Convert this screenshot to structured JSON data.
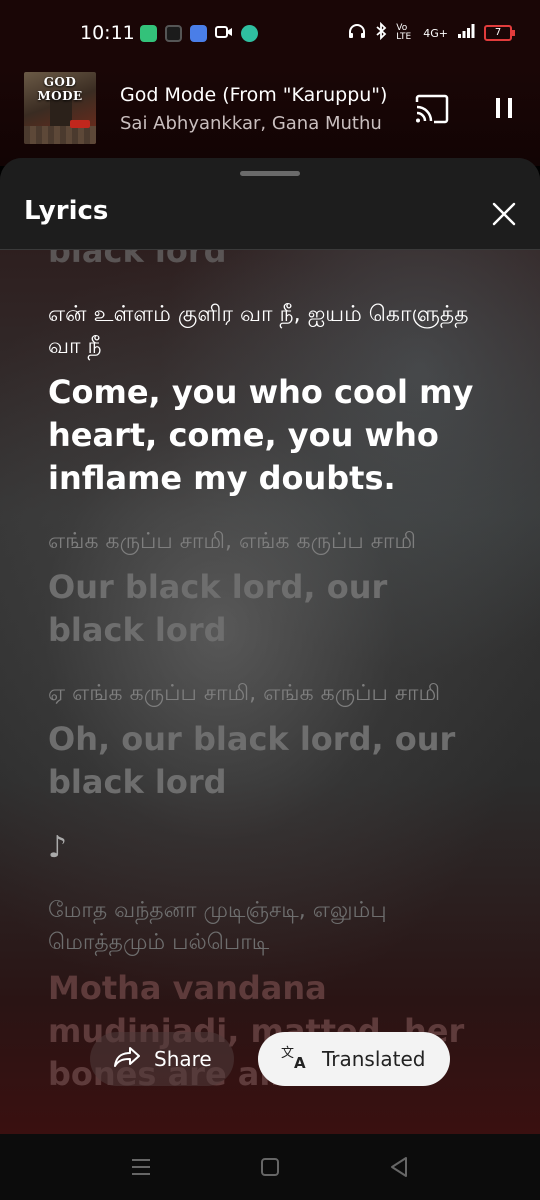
{
  "status_bar": {
    "time": "10:11",
    "battery_level": "7",
    "network_label": "4G+",
    "volte_label": "Vo LTE",
    "app_icons": [
      "battery-saver-icon",
      "shazam-icon",
      "meet-icon",
      "video-icon",
      "chat-icon"
    ],
    "status_icons": [
      "headphones-icon",
      "bluetooth-icon",
      "signal-icon"
    ]
  },
  "player": {
    "album_art_title": "GOD MODE",
    "track_title": "God Mode (From \"Karuppu\")",
    "artist": "Sai Abhyankkar, Gana Muthu"
  },
  "lyrics_sheet": {
    "title": "Lyrics",
    "lines": [
      {
        "state": "prev",
        "original": "",
        "translation": "black lord"
      },
      {
        "state": "active",
        "original": "என் உள்ளம் குளிர வா நீ, ஐயம் கொளுத்த வா நீ",
        "translation": "Come, you who cool my heart, come, you who inflame my doubts."
      },
      {
        "state": "dim",
        "original": "எங்க கருப்ப சாமி, எங்க கருப்ப சாமி",
        "translation": "Our black lord, our black lord"
      },
      {
        "state": "dim",
        "original": "ஏ எங்க கருப்ப சாமி, எங்க கருப்ப சாமி",
        "translation": "Oh, our black lord, our black lord"
      }
    ],
    "note_symbol": "♪",
    "next_line": {
      "original": "மோத வந்தனா முடிஞ்சடி, எலும்பு மொத்தமும் பல்பொடி",
      "translation": "Motha vandana mudinjadi, matted, her bones are all"
    }
  },
  "actions": {
    "share_label": "Share",
    "translated_label": "Translated"
  },
  "colors": {
    "accent_dark_red": "#1a0606",
    "battery_low": "#e23c3c",
    "chip_light": "#f3f3f3"
  }
}
